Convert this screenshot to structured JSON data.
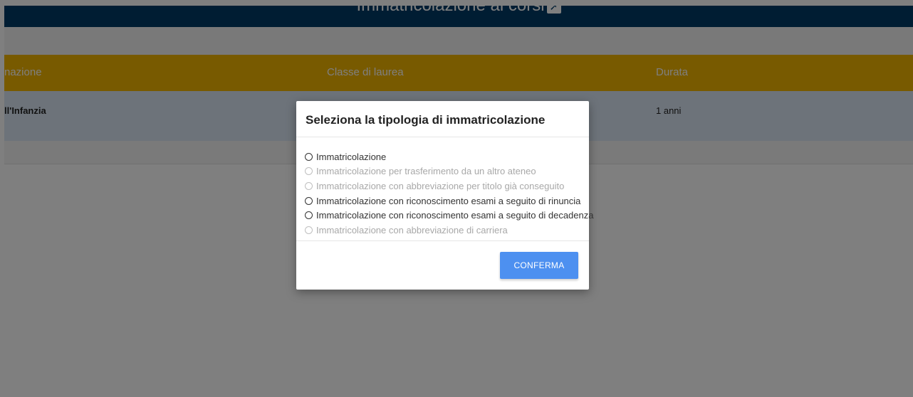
{
  "header": {
    "title": "Immatricolazione ai corsi"
  },
  "table": {
    "columns": [
      "nazione",
      "Classe di laurea",
      "Durata"
    ],
    "rows": [
      {
        "denominazione": "ll'Infanzia",
        "classe": "",
        "durata": "1 anni"
      }
    ]
  },
  "modal": {
    "title": "Seleziona la tipologia di immatricolazione",
    "options": [
      {
        "label": "Immatricolazione",
        "enabled": true
      },
      {
        "label": "Immatricolazione per trasferimento da un altro ateneo",
        "enabled": false
      },
      {
        "label": "Immatricolazione con abbreviazione per titolo già conseguito",
        "enabled": false
      },
      {
        "label": "Immatricolazione con riconoscimento esami a seguito di rinuncia",
        "enabled": true
      },
      {
        "label": "Immatricolazione con riconoscimento esami a seguito di decadenza",
        "enabled": true
      },
      {
        "label": "Immatricolazione con abbreviazione di carriera",
        "enabled": false
      }
    ],
    "confirm_label": "CONFERMA"
  },
  "colors": {
    "header": "#003a66",
    "table_header": "#f0b400",
    "row": "#dbe7f5",
    "button": "#4d90f0",
    "overlay": "rgba(0,0,0,0.5)"
  }
}
